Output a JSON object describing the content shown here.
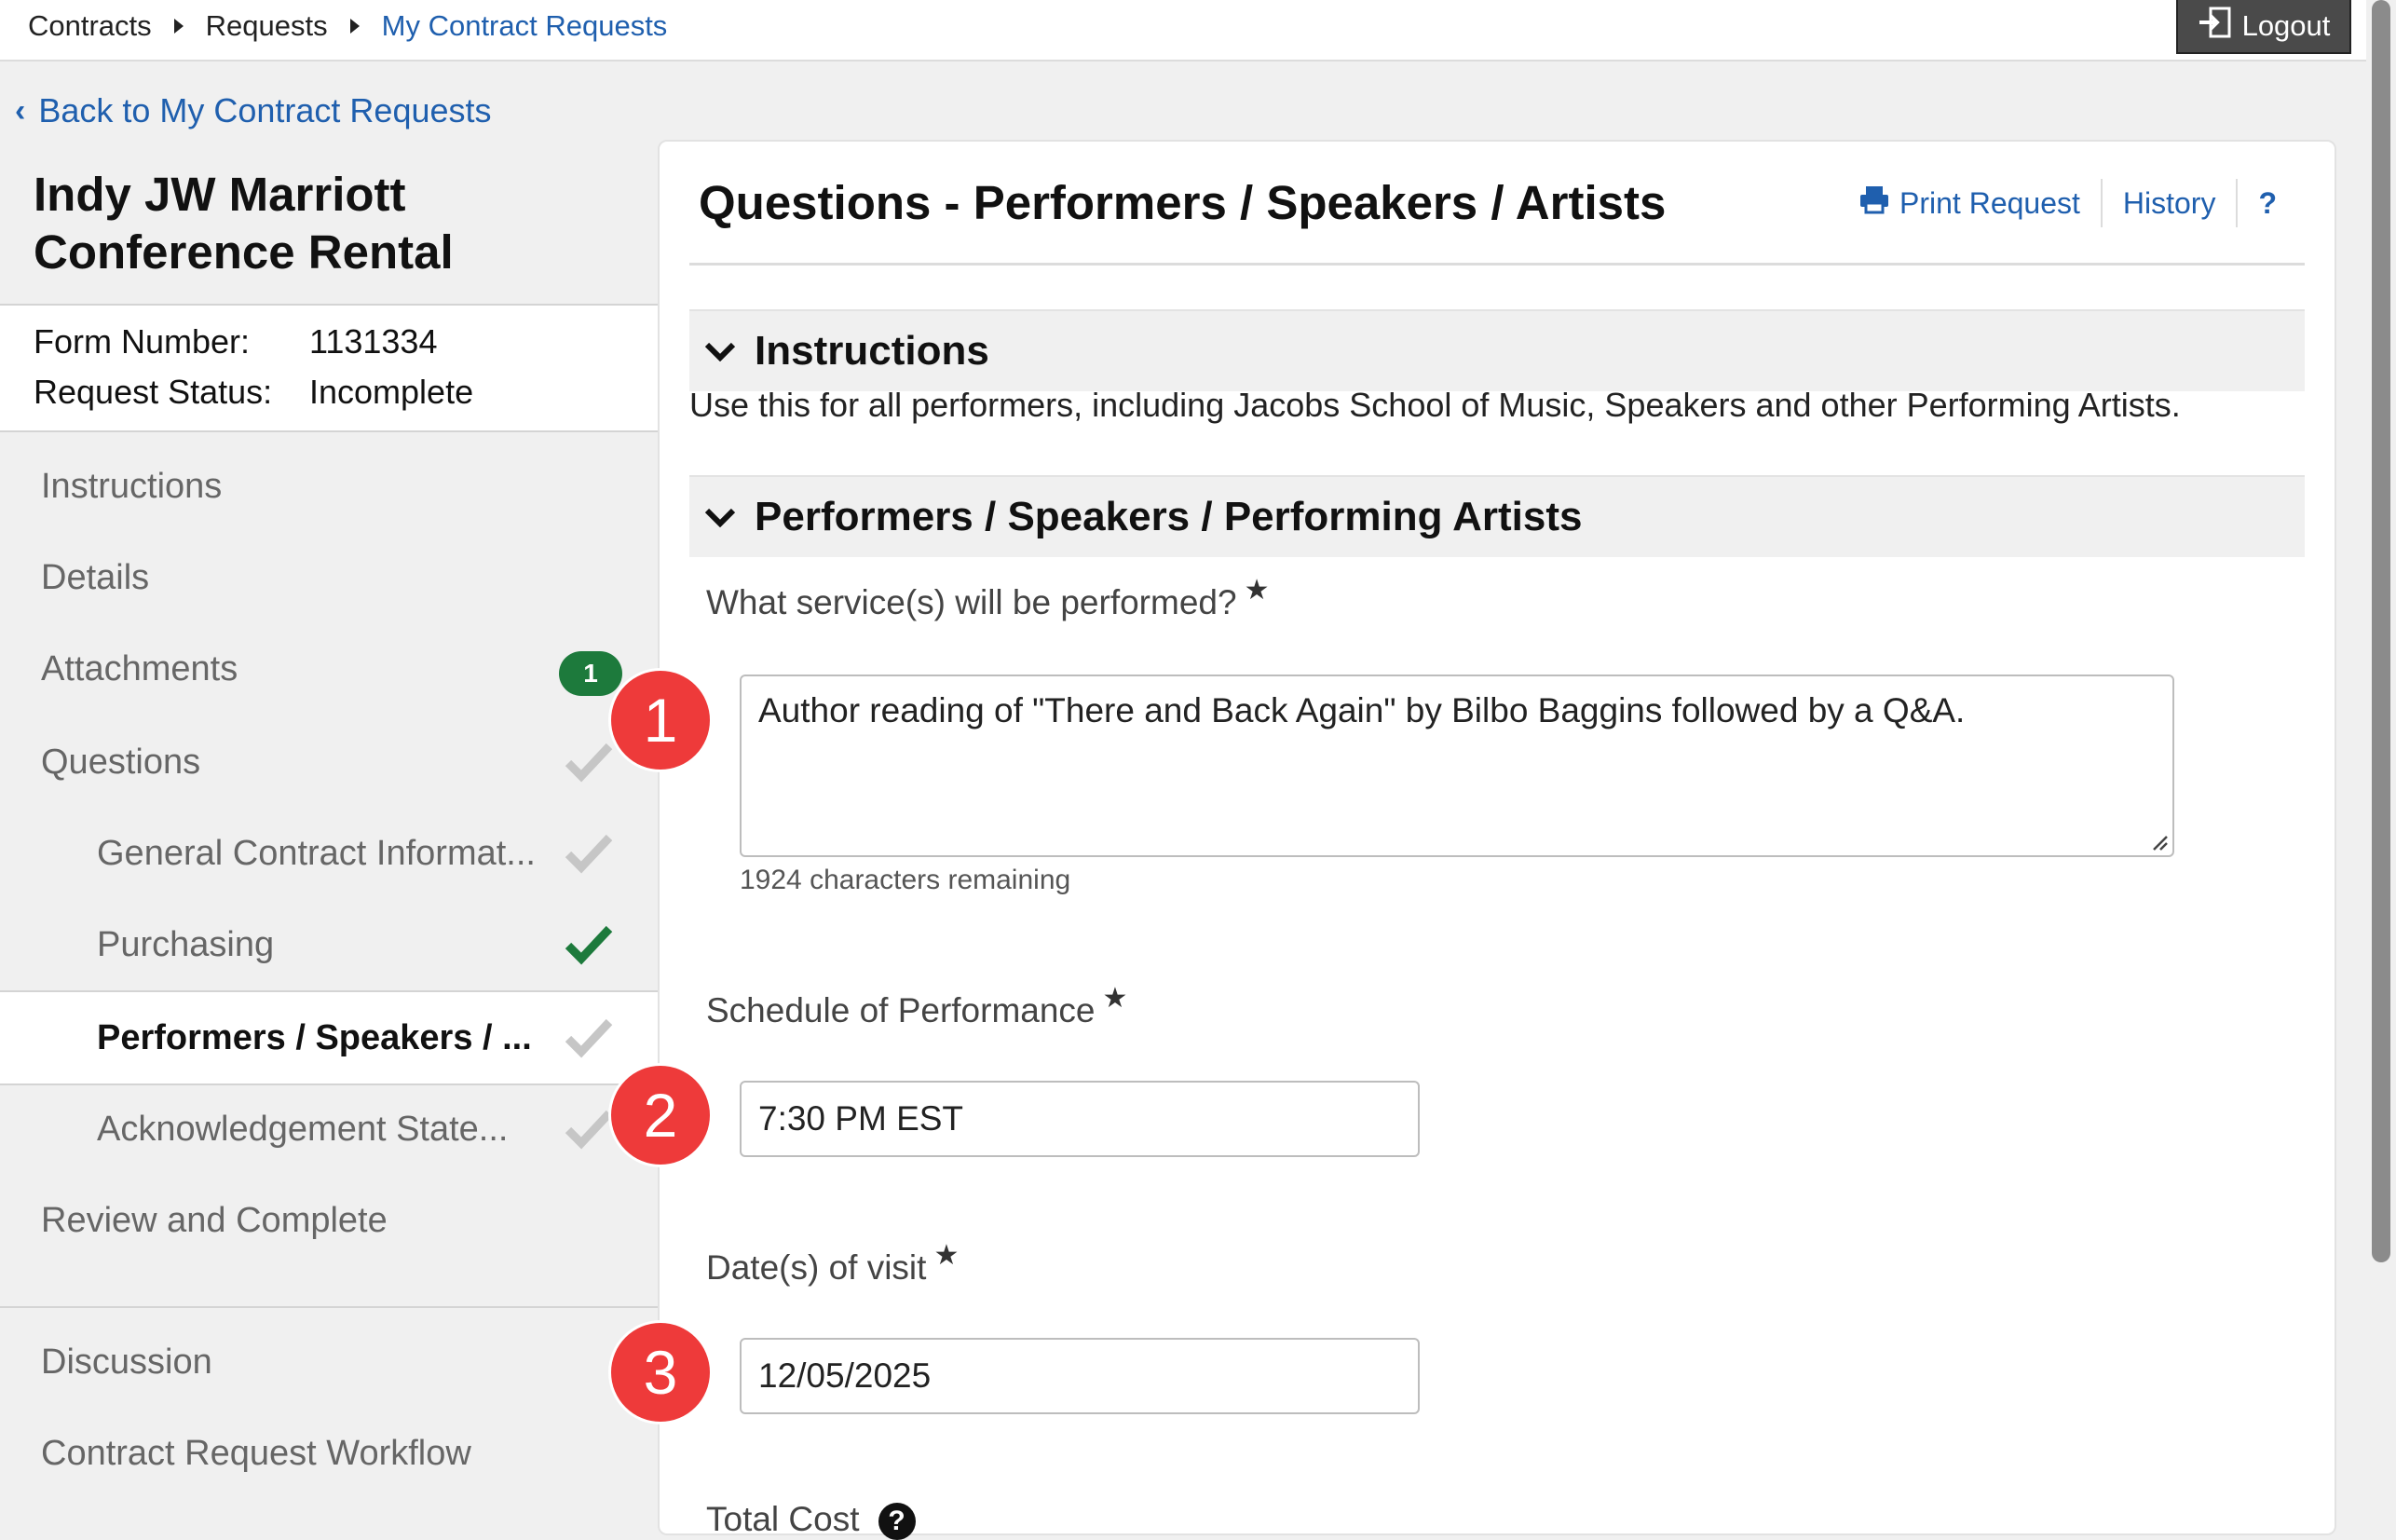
{
  "breadcrumb": {
    "items": [
      "Contracts",
      "Requests",
      "My Contract Requests"
    ]
  },
  "header": {
    "logout_label": "Logout"
  },
  "back_link": {
    "label": "Back to My Contract Requests"
  },
  "request": {
    "title_line1": "Indy JW Marriott",
    "title_line2": "Conference Rental",
    "form_number_label": "Form Number:",
    "form_number": "1131334",
    "status_label": "Request Status:",
    "status": "Incomplete"
  },
  "sidebar": {
    "items": [
      {
        "label": "Instructions"
      },
      {
        "label": "Details"
      },
      {
        "label": "Attachments",
        "badge": "1"
      },
      {
        "label": "Questions",
        "check": "gray"
      },
      {
        "label": "General Contract Informat...",
        "check": "gray"
      },
      {
        "label": "Purchasing",
        "check": "green"
      },
      {
        "label": "Performers / Speakers / ...",
        "check": "gray"
      },
      {
        "label": "Acknowledgement State...",
        "check": "gray"
      },
      {
        "label": "Review and Complete"
      },
      {
        "label": "Discussion"
      },
      {
        "label": "Contract Request Workflow"
      }
    ],
    "check_colors": {
      "gray": "#c6c6c6",
      "green": "#1d7a3c"
    }
  },
  "panel": {
    "title": "Questions - Performers / Speakers / Artists",
    "print_label": "Print Request",
    "history_label": "History",
    "help_label": "?"
  },
  "instructions": {
    "heading": "Instructions",
    "text": "Use this for all performers, including Jacobs School of Music, Speakers and other Performing Artists."
  },
  "performers": {
    "heading": "Performers / Speakers / Performing Artists",
    "service_label": "What service(s) will be performed?",
    "service_value": "Author reading of \"There and Back Again\" by Bilbo Baggins followed by a Q&A.",
    "chars_remaining": "1924 characters remaining",
    "schedule_label": "Schedule of Performance",
    "schedule_value": "7:30 PM EST",
    "dates_label": "Date(s) of visit",
    "dates_value": "12/05/2025",
    "total_cost_label": "Total Cost",
    "required_mark": "★"
  },
  "annotations": [
    "1",
    "2",
    "3"
  ],
  "colors": {
    "link": "#1f5fae",
    "annotation": "#ee3a3a",
    "badge": "#1d7a3c"
  }
}
